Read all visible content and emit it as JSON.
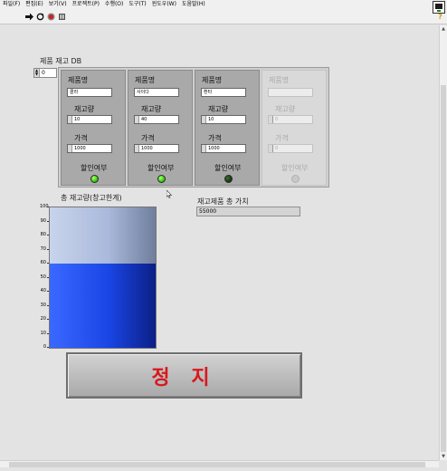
{
  "menu": [
    "파일(F)",
    "편집(E)",
    "보기(V)",
    "프로젝트(P)",
    "수행(O)",
    "도구(T)",
    "윈도우(W)",
    "도움말(H)"
  ],
  "toolbar": {
    "run_icon": "run-arrow-icon",
    "continuous_icon": "run-continuously-icon",
    "abort_icon": "abort-icon",
    "pause_icon": "pause-icon"
  },
  "db": {
    "label": "제품 재고 DB",
    "index": "0",
    "field_labels": {
      "name": "제품명",
      "qty": "재고량",
      "price": "가격",
      "discount": "할인여부"
    },
    "items": [
      {
        "name": "콜라",
        "qty": "10",
        "price": "1000",
        "discount": "on"
      },
      {
        "name": "사이다",
        "qty": "40",
        "price": "1000",
        "discount": "on"
      },
      {
        "name": "환타",
        "qty": "10",
        "price": "1000",
        "discount": "off"
      },
      {
        "name": "",
        "qty": "0",
        "price": "0",
        "discount": "disabled"
      }
    ]
  },
  "tank": {
    "label": "총 재고량(창고한계)",
    "scale": [
      "100",
      "90",
      "80",
      "70",
      "60",
      "50",
      "40",
      "30",
      "20",
      "10",
      "0"
    ],
    "value": 60,
    "max": 100
  },
  "total_value": {
    "label": "재고제품 총 가치",
    "value": "55000"
  },
  "stop_button": {
    "label": "정 지"
  },
  "colors": {
    "led_on": "#42d81a",
    "led_off": "#183d10",
    "tank_fill": "#1a46e6",
    "stop_text": "#d8181d"
  }
}
